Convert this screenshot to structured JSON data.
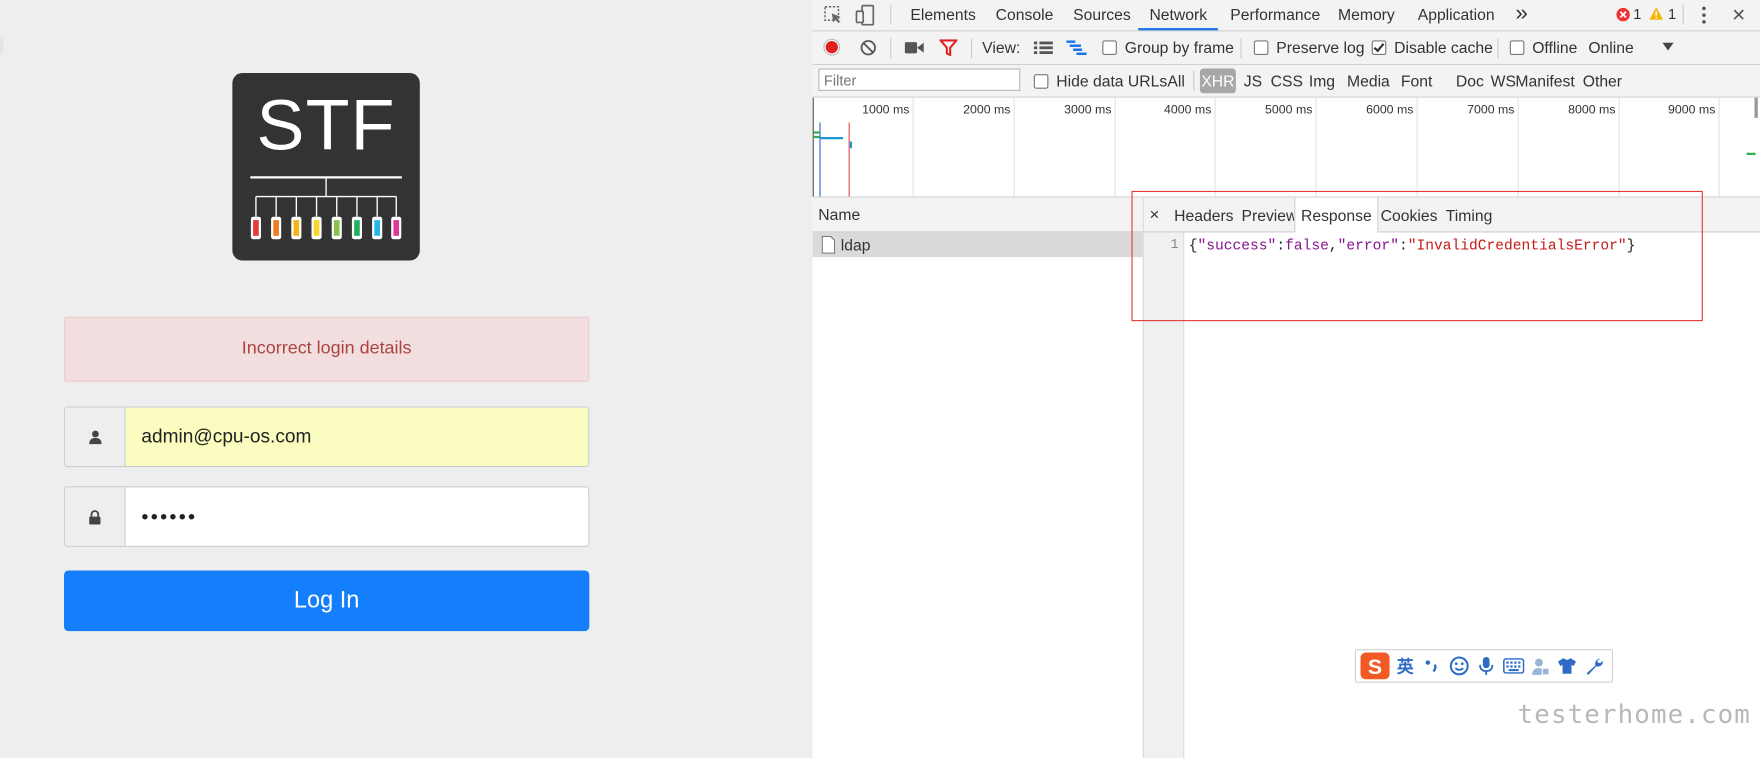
{
  "login": {
    "logo_text": "STF",
    "alert": "Incorrect login details",
    "email_value": "admin@cpu-os.com",
    "password_value": "••••••",
    "login_button": "Log In",
    "device_colors": [
      "#e43a3a",
      "#f07b22",
      "#f2b51c",
      "#f5d82b",
      "#8bc34a",
      "#20b25a",
      "#23b7e5",
      "#e0379a"
    ]
  },
  "devtools": {
    "tabs": [
      "Elements",
      "Console",
      "Sources",
      "Network",
      "Performance",
      "Memory",
      "Application"
    ],
    "active_tab": "Network",
    "more_tabs": "»",
    "error_count": "1",
    "warning_count": "1",
    "toolbar": {
      "view_label": "View:",
      "group_by_frame": "Group by frame",
      "preserve_log": "Preserve log",
      "disable_cache": "Disable cache",
      "offline": "Offline",
      "throttle": "Online"
    },
    "filter": {
      "placeholder": "Filter",
      "hide_data_urls": "Hide data URLs",
      "types": [
        "All",
        "XHR",
        "JS",
        "CSS",
        "Img",
        "Media",
        "Font",
        "Doc",
        "WS",
        "Manifest",
        "Other"
      ],
      "active_type": "XHR"
    },
    "timeline_ticks": [
      "1000 ms",
      "2000 ms",
      "3000 ms",
      "4000 ms",
      "5000 ms",
      "6000 ms",
      "7000 ms",
      "8000 ms",
      "9000 ms"
    ],
    "requests": {
      "header": "Name",
      "items": [
        "ldap"
      ]
    },
    "detail": {
      "close": "×",
      "tabs": [
        "Headers",
        "Preview",
        "Response",
        "Cookies",
        "Timing"
      ],
      "active_tab": "Response",
      "line_number": "1",
      "code": {
        "open": "{",
        "key1": "\"success\"",
        "colon1": ":",
        "val1": "false",
        "comma": ",",
        "key2": "\"error\"",
        "colon2": ":",
        "val2": "\"InvalidCredentialsError\"",
        "close": "}"
      }
    }
  },
  "ime": {
    "items": [
      "S",
      "英",
      "•,",
      "☺",
      "mic",
      "kbd",
      "user",
      "shirt",
      "wrench"
    ],
    "lang": "英"
  },
  "watermark": "testerhome.com"
}
